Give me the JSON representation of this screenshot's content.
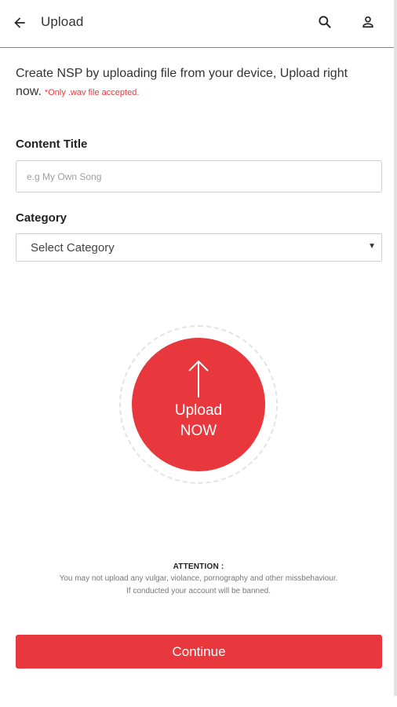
{
  "app_bar": {
    "title": "Upload",
    "back_icon": "arrow-back-icon",
    "search_icon": "search-icon",
    "account_icon": "person-icon"
  },
  "intro": {
    "text": "Create NSP by uploading file from your device, Upload right now.",
    "note": "*Only .wav file accepted."
  },
  "form": {
    "content_title_label": "Content Title",
    "content_title_placeholder": "e.g My Own Song",
    "content_title_value": "",
    "category_label": "Category",
    "category_selected": "Select Category"
  },
  "upload": {
    "line1": "Upload",
    "line2": "NOW",
    "icon": "arrow-up-icon"
  },
  "attention": {
    "heading": "ATTENTION :",
    "line1": "You may not upload any vulgar, violance, pornography and other missbehaviour.",
    "line2": "If conducted your account will be banned."
  },
  "continue_label": "Continue",
  "colors": {
    "accent": "#e8383d",
    "divider": "#8a8a8a"
  }
}
